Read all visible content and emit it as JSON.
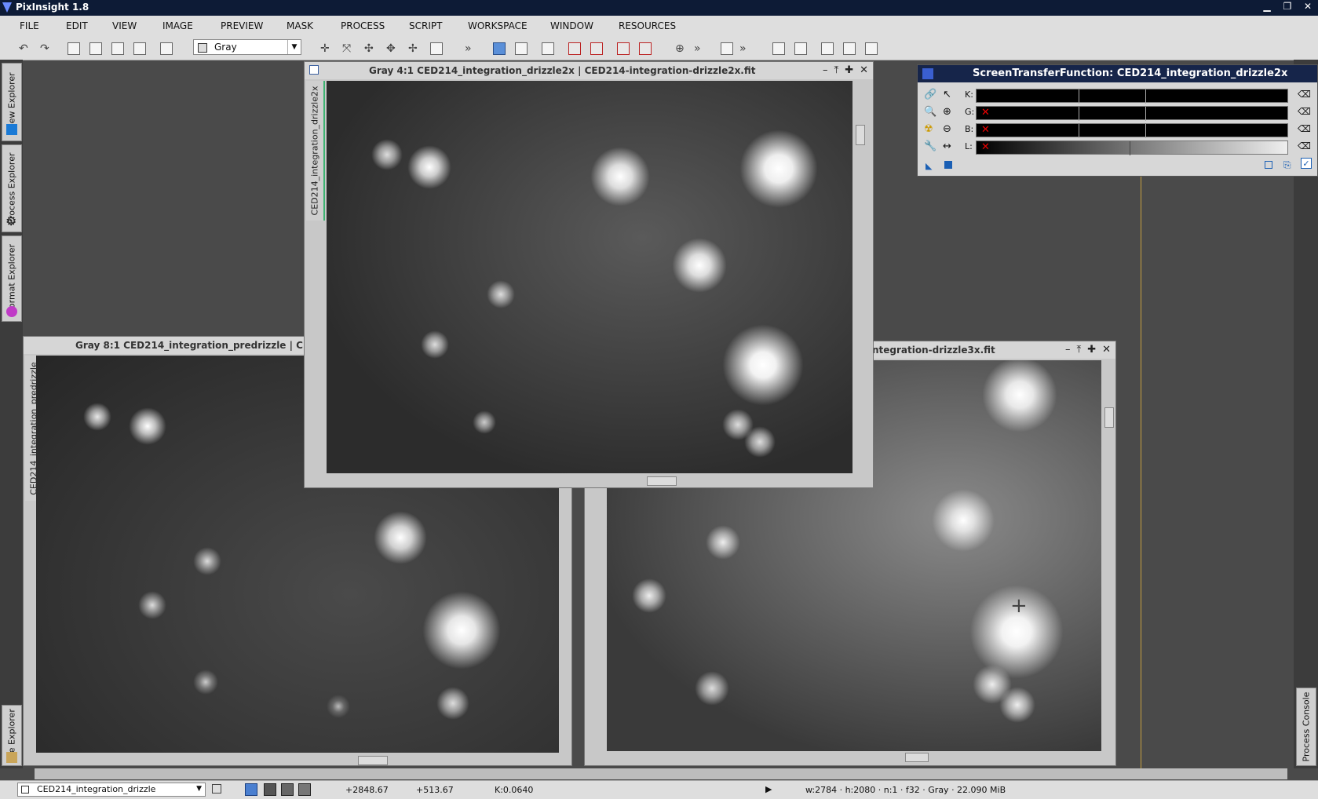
{
  "app": {
    "title": "PixInsight 1.8"
  },
  "menu": [
    "FILE",
    "EDIT",
    "VIEW",
    "IMAGE",
    "PREVIEW",
    "MASK",
    "PROCESS",
    "SCRIPT",
    "WORKSPACE",
    "WINDOW",
    "RESOURCES"
  ],
  "toolbar": {
    "color_mode": "Gray",
    "overflow": "»"
  },
  "left_dock": {
    "view_explorer": "View Explorer",
    "process_explorer": "Process Explorer",
    "format_explorer": "Format Explorer",
    "file_explorer": "File Explorer"
  },
  "right_dock": {
    "process_console": "Process Console"
  },
  "windows": {
    "drizzle2x": {
      "title": "Gray 4:1 CED214_integration_drizzle2x | CED214-integration-drizzle2x.fit",
      "tab": "CED214_integration_drizzle2x"
    },
    "predrizzle": {
      "title": "Gray 8:1 CED214_integration_predrizzle | C",
      "tab": "CED214_integration_predrizzle"
    },
    "drizzle3x": {
      "title": "ntegration-drizzle3x.fit"
    }
  },
  "stf": {
    "title": "ScreenTransferFunction: CED214_integration_drizzle2x",
    "channels": [
      "K:",
      "G:",
      "B:",
      "L:"
    ]
  },
  "status": {
    "view": "CED214_integration_drizzle",
    "x": "+2848.67",
    "y": "+513.67",
    "k": "K:0.0640",
    "info": "w:2784 · h:2080 · n:1 · f32 · Gray · 22.090 MiB"
  },
  "colors": {
    "titlebar": "#0d1b36",
    "panel": "#dedede",
    "accent_green": "#3cb371",
    "cursor_line": "#c8a040"
  }
}
